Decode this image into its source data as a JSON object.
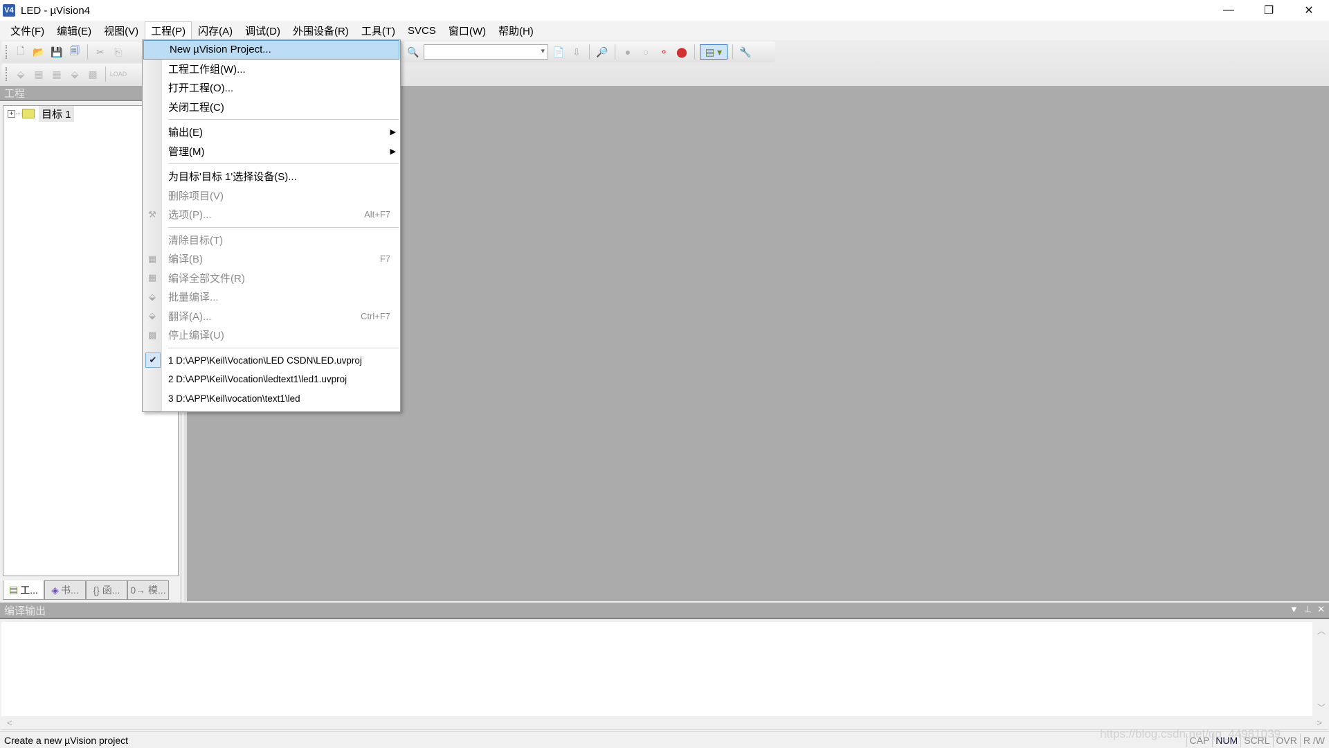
{
  "window": {
    "title": "LED  - µVision4",
    "app_icon": "V4",
    "controls": {
      "minimize": "—",
      "restore": "❐",
      "close": "✕"
    }
  },
  "menubar": [
    {
      "label": "文件(F)"
    },
    {
      "label": "编辑(E)"
    },
    {
      "label": "视图(V)"
    },
    {
      "label": "工程(P)",
      "open": true
    },
    {
      "label": "闪存(A)"
    },
    {
      "label": "调试(D)"
    },
    {
      "label": "外围设备(R)"
    },
    {
      "label": "工具(T)"
    },
    {
      "label": "SVCS"
    },
    {
      "label": "窗口(W)"
    },
    {
      "label": "帮助(H)"
    }
  ],
  "toolbar": {
    "row1_icons": [
      "new-file",
      "open-folder",
      "save",
      "save-all",
      "cut",
      "copy",
      "paste"
    ],
    "row1_right_icons": [
      "find-in-files",
      "find-document",
      "incremental-find",
      "debug-zoom",
      "breakpoint-insert",
      "breakpoint-enable",
      "breakpoint-disable",
      "breakpoint-kill-all",
      "window-layout",
      "configure"
    ],
    "row1_combo_value": "",
    "row2_icons": [
      "translate",
      "build",
      "rebuild",
      "batch-build",
      "stop-build",
      "load"
    ]
  },
  "project_panel": {
    "title": "工程",
    "tree": [
      {
        "label": "目标 1",
        "expand": "+"
      }
    ],
    "tabs": [
      {
        "label": "工...",
        "icon": "project-icon",
        "active": true
      },
      {
        "label": "书...",
        "icon": "books-icon"
      },
      {
        "label": "{} 函...",
        "icon": "functions-icon"
      },
      {
        "label": "0→ 模...",
        "icon": "templates-icon"
      }
    ]
  },
  "project_menu": {
    "items": [
      {
        "type": "item",
        "label": "New µVision Project...",
        "highlighted": true
      },
      {
        "type": "item",
        "label": "工程工作组(W)..."
      },
      {
        "type": "item",
        "label": "打开工程(O)..."
      },
      {
        "type": "item",
        "label": "关闭工程(C)"
      },
      {
        "type": "sep"
      },
      {
        "type": "item",
        "label": "输出(E)",
        "submenu": true
      },
      {
        "type": "item",
        "label": "管理(M)",
        "submenu": true
      },
      {
        "type": "sep"
      },
      {
        "type": "item",
        "label": "为目标'目标 1'选择设备(S)..."
      },
      {
        "type": "item",
        "label": "删除项目(V)",
        "disabled": true
      },
      {
        "type": "item",
        "label": "选项(P)...",
        "shortcut": "Alt+F7",
        "disabled": true,
        "icon": "options-icon"
      },
      {
        "type": "sep"
      },
      {
        "type": "item",
        "label": "清除目标(T)",
        "disabled": true
      },
      {
        "type": "item",
        "label": "编译(B)",
        "shortcut": "F7",
        "disabled": true,
        "icon": "build-icon"
      },
      {
        "type": "item",
        "label": "编译全部文件(R)",
        "disabled": true,
        "icon": "rebuild-icon"
      },
      {
        "type": "item",
        "label": "批量编译...",
        "disabled": true,
        "icon": "batch-build-icon"
      },
      {
        "type": "item",
        "label": "翻译(A)...",
        "shortcut": "Ctrl+F7",
        "disabled": true,
        "icon": "translate-icon"
      },
      {
        "type": "item",
        "label": "停止编译(U)",
        "disabled": true,
        "icon": "stop-build-icon"
      },
      {
        "type": "sep"
      },
      {
        "type": "recent",
        "label": "1 D:\\APP\\Keil\\Vocation\\LED   CSDN\\LED.uvproj",
        "checked": true
      },
      {
        "type": "recent",
        "label": "2 D:\\APP\\Keil\\Vocation\\ledtext1\\led1.uvproj"
      },
      {
        "type": "recent",
        "label": "3 D:\\APP\\Keil\\vocation\\text1\\led"
      }
    ]
  },
  "build_output": {
    "title": "编译输出",
    "content": ""
  },
  "statusbar": {
    "message": "Create a new µVision project",
    "indicators": [
      {
        "label": "CAP",
        "on": false
      },
      {
        "label": "NUM",
        "on": true
      },
      {
        "label": "SCRL",
        "on": false
      },
      {
        "label": "OVR",
        "on": false
      },
      {
        "label": "R /W",
        "on": false
      }
    ],
    "watermark": "https://blog.csdn.net/qq_44981039"
  }
}
